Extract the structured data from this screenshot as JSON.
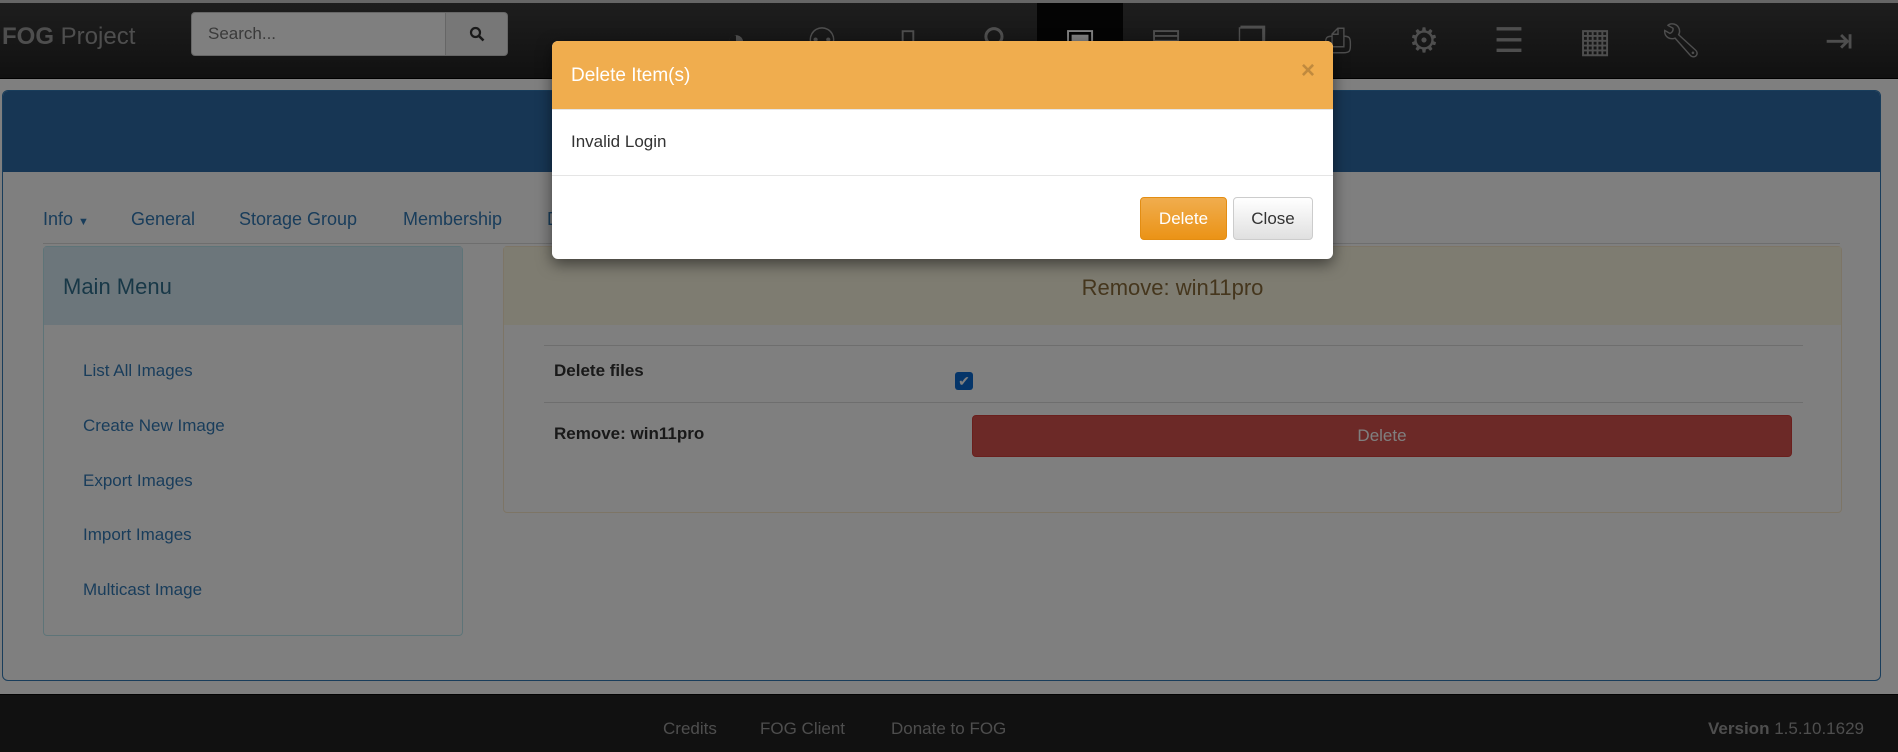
{
  "navbar": {
    "brand_bold": "FOG",
    "brand_rest": " Project",
    "search_placeholder": "Search...",
    "icons": [
      "dashboard-icon",
      "users-icon",
      "host-icon",
      "group-icon",
      "image-icon",
      "storage-icon",
      "snapin-icon",
      "printer-icon",
      "service-icon",
      "tasks-icon",
      "report-icon",
      "settings-icon"
    ],
    "active_icon": "image-icon",
    "logout_icon": "logout-icon"
  },
  "tabs": [
    {
      "label": "Info"
    },
    {
      "label": "General"
    },
    {
      "label": "Storage Group"
    },
    {
      "label": "Membership"
    },
    {
      "label": "D"
    }
  ],
  "main_menu": {
    "title": "Main Menu",
    "items": [
      "List All Images",
      "Create New Image",
      "Export Images",
      "Import Images",
      "Multicast Image"
    ]
  },
  "remove_panel": {
    "title": "Remove: win11pro",
    "delete_files_label": "Delete files",
    "delete_files_checked": true,
    "remove_label": "Remove: win11pro",
    "delete_button": "Delete"
  },
  "footer": {
    "links": [
      "Credits",
      "FOG Client",
      "Donate to FOG"
    ],
    "version_label": "Version",
    "version": "1.5.10.1629"
  },
  "modal": {
    "title": "Delete Item(s)",
    "close_x": "×",
    "message": "Invalid Login",
    "delete_button": "Delete",
    "close_button": "Close"
  },
  "colors": {
    "modal_header": "#f0ad4e",
    "banner": "#2f6da8",
    "danger": "#d9534f",
    "navbar": "#222222"
  }
}
